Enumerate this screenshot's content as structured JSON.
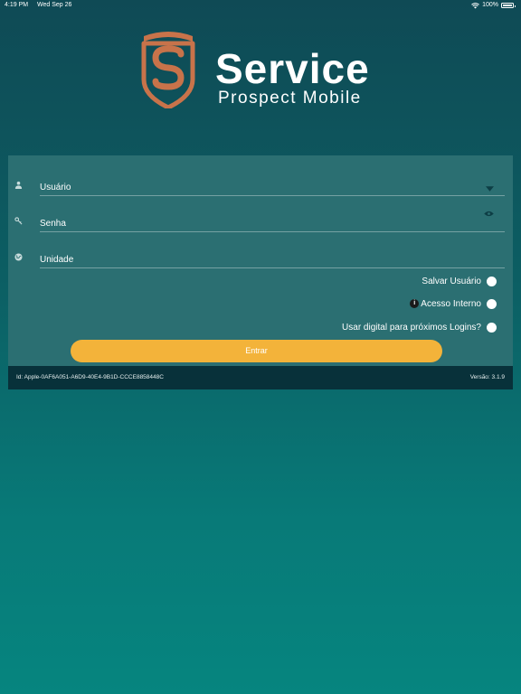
{
  "status_bar": {
    "time": "4:19 PM",
    "date": "Wed Sep 26",
    "battery": "100%"
  },
  "brand": {
    "title": "Service",
    "subtitle": "Prospect Mobile",
    "accent_color": "#c8734a"
  },
  "form": {
    "fields": [
      {
        "label": "Usuário",
        "icon": "user-icon",
        "right_icon": "chevron-down-icon"
      },
      {
        "label": "Senha",
        "icon": "key-icon",
        "right_icon": "eye-icon"
      },
      {
        "label": "Unidade",
        "icon": "globe-icon"
      }
    ],
    "options": [
      {
        "label": "Salvar Usuário"
      },
      {
        "label": "Acesso Interno",
        "icon": "info-icon"
      },
      {
        "label": "Usar digital para próximos Logins?"
      }
    ],
    "submit_label": "Entrar",
    "submit_color": "#f3b33a"
  },
  "footer": {
    "id_text": "Id: Apple-0AF6A051-A6D9-40E4-9B1D-CCCE8858448C",
    "version_text": "Versão: 3.1.9"
  }
}
